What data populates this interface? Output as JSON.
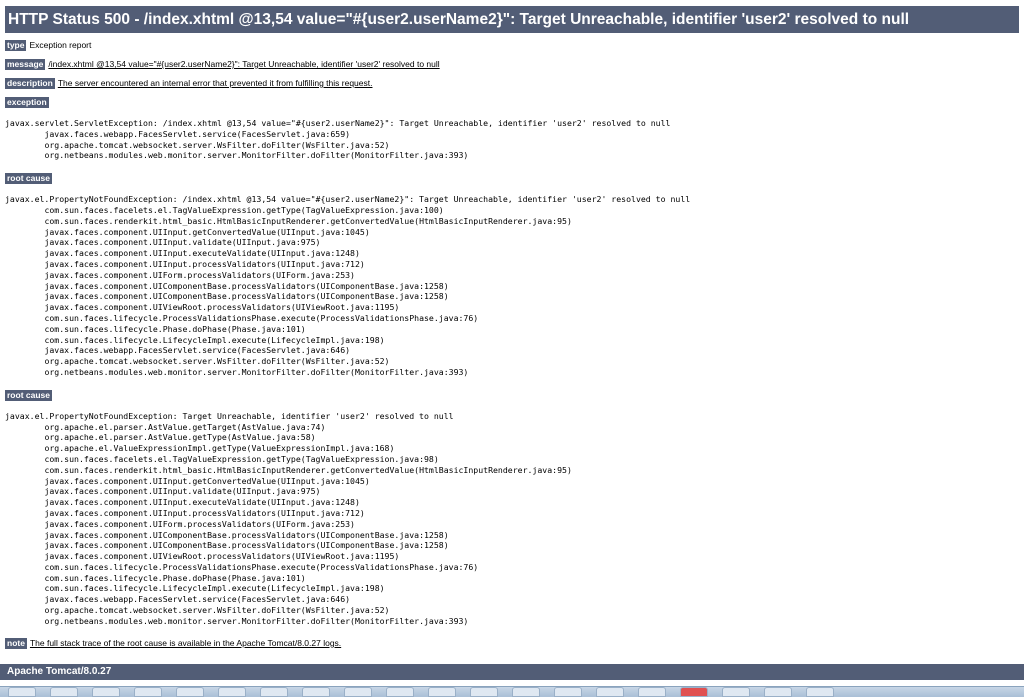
{
  "title": "HTTP Status 500 - /index.xhtml @13,54 value=\"#{user2.userName2}\": Target Unreachable, identifier 'user2' resolved to null",
  "type": {
    "label": "type",
    "value": "Exception report"
  },
  "message": {
    "label": "message",
    "value": "/index.xhtml @13,54 value=\"#{user2.userName2}\": Target Unreachable, identifier 'user2' resolved to null"
  },
  "description": {
    "label": "description",
    "value": "The server encountered an internal error that prevented it from fulfilling this request."
  },
  "exception": {
    "label": "exception",
    "trace": "javax.servlet.ServletException: /index.xhtml @13,54 value=\"#{user2.userName2}\": Target Unreachable, identifier 'user2' resolved to null\n\tjavax.faces.webapp.FacesServlet.service(FacesServlet.java:659)\n\torg.apache.tomcat.websocket.server.WsFilter.doFilter(WsFilter.java:52)\n\torg.netbeans.modules.web.monitor.server.MonitorFilter.doFilter(MonitorFilter.java:393)"
  },
  "root_cause_1": {
    "label": "root cause",
    "trace": "javax.el.PropertyNotFoundException: /index.xhtml @13,54 value=\"#{user2.userName2}\": Target Unreachable, identifier 'user2' resolved to null\n\tcom.sun.faces.facelets.el.TagValueExpression.getType(TagValueExpression.java:100)\n\tcom.sun.faces.renderkit.html_basic.HtmlBasicInputRenderer.getConvertedValue(HtmlBasicInputRenderer.java:95)\n\tjavax.faces.component.UIInput.getConvertedValue(UIInput.java:1045)\n\tjavax.faces.component.UIInput.validate(UIInput.java:975)\n\tjavax.faces.component.UIInput.executeValidate(UIInput.java:1248)\n\tjavax.faces.component.UIInput.processValidators(UIInput.java:712)\n\tjavax.faces.component.UIForm.processValidators(UIForm.java:253)\n\tjavax.faces.component.UIComponentBase.processValidators(UIComponentBase.java:1258)\n\tjavax.faces.component.UIComponentBase.processValidators(UIComponentBase.java:1258)\n\tjavax.faces.component.UIViewRoot.processValidators(UIViewRoot.java:1195)\n\tcom.sun.faces.lifecycle.ProcessValidationsPhase.execute(ProcessValidationsPhase.java:76)\n\tcom.sun.faces.lifecycle.Phase.doPhase(Phase.java:101)\n\tcom.sun.faces.lifecycle.LifecycleImpl.execute(LifecycleImpl.java:198)\n\tjavax.faces.webapp.FacesServlet.service(FacesServlet.java:646)\n\torg.apache.tomcat.websocket.server.WsFilter.doFilter(WsFilter.java:52)\n\torg.netbeans.modules.web.monitor.server.MonitorFilter.doFilter(MonitorFilter.java:393)"
  },
  "root_cause_2": {
    "label": "root cause",
    "trace": "javax.el.PropertyNotFoundException: Target Unreachable, identifier 'user2' resolved to null\n\torg.apache.el.parser.AstValue.getTarget(AstValue.java:74)\n\torg.apache.el.parser.AstValue.getType(AstValue.java:58)\n\torg.apache.el.ValueExpressionImpl.getType(ValueExpressionImpl.java:168)\n\tcom.sun.faces.facelets.el.TagValueExpression.getType(TagValueExpression.java:98)\n\tcom.sun.faces.renderkit.html_basic.HtmlBasicInputRenderer.getConvertedValue(HtmlBasicInputRenderer.java:95)\n\tjavax.faces.component.UIInput.getConvertedValue(UIInput.java:1045)\n\tjavax.faces.component.UIInput.validate(UIInput.java:975)\n\tjavax.faces.component.UIInput.executeValidate(UIInput.java:1248)\n\tjavax.faces.component.UIInput.processValidators(UIInput.java:712)\n\tjavax.faces.component.UIForm.processValidators(UIForm.java:253)\n\tjavax.faces.component.UIComponentBase.processValidators(UIComponentBase.java:1258)\n\tjavax.faces.component.UIComponentBase.processValidators(UIComponentBase.java:1258)\n\tjavax.faces.component.UIViewRoot.processValidators(UIViewRoot.java:1195)\n\tcom.sun.faces.lifecycle.ProcessValidationsPhase.execute(ProcessValidationsPhase.java:76)\n\tcom.sun.faces.lifecycle.Phase.doPhase(Phase.java:101)\n\tcom.sun.faces.lifecycle.LifecycleImpl.execute(LifecycleImpl.java:198)\n\tjavax.faces.webapp.FacesServlet.service(FacesServlet.java:646)\n\torg.apache.tomcat.websocket.server.WsFilter.doFilter(WsFilter.java:52)\n\torg.netbeans.modules.web.monitor.server.MonitorFilter.doFilter(MonitorFilter.java:393)"
  },
  "note": {
    "label": "note",
    "value": "The full stack trace of the root cause is available in the Apache Tomcat/8.0.27 logs."
  },
  "footer": "Apache Tomcat/8.0.27",
  "colors": {
    "header_bg": "#525D76",
    "header_text": "#ffffff",
    "text": "#000000"
  }
}
